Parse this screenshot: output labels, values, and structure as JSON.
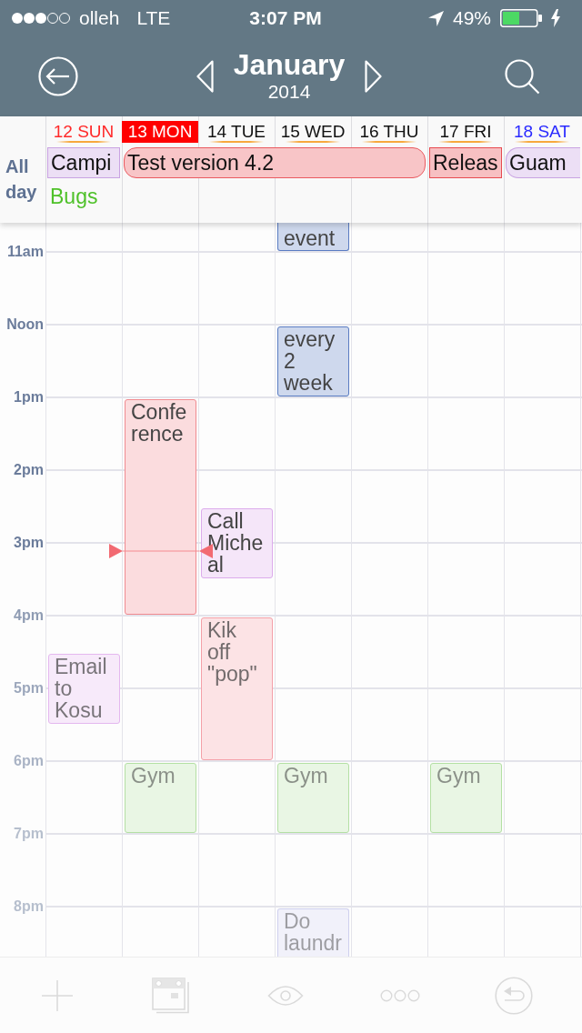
{
  "status_bar": {
    "carrier": "olleh",
    "network": "LTE",
    "time": "3:07 PM",
    "battery": "49%"
  },
  "nav": {
    "month": "January",
    "year": "2014"
  },
  "all_day_label": "All day",
  "days": [
    {
      "label": "12 SUN",
      "color": "#ff2a2a",
      "selected": false,
      "all_day": [
        {
          "kind": "bar",
          "title": "Campi",
          "color": "#c9a3e2"
        },
        {
          "kind": "text",
          "title": "Bugs",
          "color": "#4fc12a"
        }
      ],
      "events": [
        {
          "title": "Email to Kosu",
          "color": "#e4b8ef"
        }
      ]
    },
    {
      "label": "13 MON",
      "color": "#ff0000",
      "selected": true,
      "all_day": [
        {
          "kind": "bar",
          "title": "Test version 4.2",
          "color": "#ea5a60"
        }
      ],
      "events": [
        {
          "title": "Conference",
          "color": "#f08a90"
        },
        {
          "title": "Gym",
          "color": "#b4e0a4"
        }
      ]
    },
    {
      "label": "14 TUE",
      "color": "#111111",
      "selected": false,
      "events": [
        {
          "title": "Call Micheal",
          "color": "#dcacec"
        },
        {
          "title": "Kik off \"pop\"",
          "color": "#f4a0a8"
        }
      ]
    },
    {
      "label": "15 WED",
      "color": "#111111",
      "selected": false,
      "events": [
        {
          "title": "event",
          "color": "#5a7cc2"
        },
        {
          "title": "every 2 week",
          "color": "#5a7cc2"
        },
        {
          "title": "Gym",
          "color": "#b4e0a4"
        },
        {
          "title": "Do laundr",
          "color": "#cfd0ee"
        }
      ]
    },
    {
      "label": "16 THU",
      "color": "#111111",
      "selected": false
    },
    {
      "label": "17 FRI",
      "color": "#111111",
      "selected": false,
      "all_day": [
        {
          "kind": "bar",
          "title": "Releas",
          "color": "#e84a50"
        }
      ],
      "events": [
        {
          "title": "Gym",
          "color": "#b4e0a4"
        }
      ]
    },
    {
      "label": "18 SAT",
      "color": "#2a2aff",
      "selected": false,
      "all_day": [
        {
          "kind": "bar",
          "title": "Guam",
          "color": "#c9a3e2"
        }
      ]
    }
  ],
  "grid": {
    "hours": [
      "11am",
      "Noon",
      "1pm",
      "2pm",
      "3pm",
      "4pm",
      "5pm",
      "6pm",
      "7pm",
      "8pm"
    ]
  }
}
